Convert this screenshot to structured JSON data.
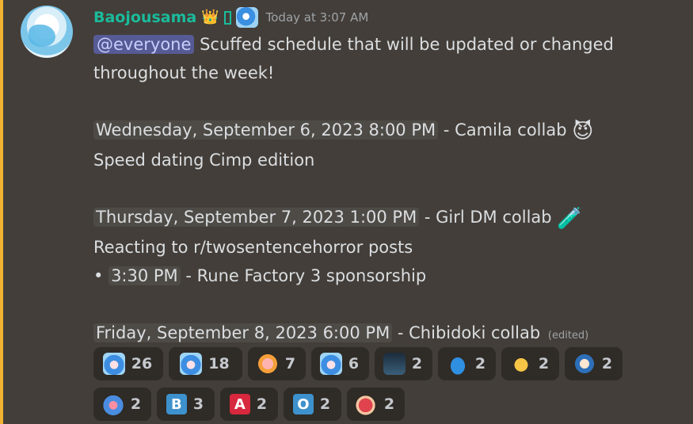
{
  "message": {
    "username": "Baojousama",
    "role_icon_crown": "👑",
    "timestamp": "Today at 3:07 AM",
    "mention": "@everyone",
    "line1_text": " Scuffed schedule that will be updated or changed",
    "line2_text": "throughout the week!",
    "events": {
      "wed_time": "Wednesday, September 6, 2023 8:00 PM",
      "wed_desc": " - Camila collab ",
      "wed_emoji": "😈",
      "wed_note": "Speed dating Cimp edition",
      "thu_time": "Thursday, September 7, 2023 1:00 PM",
      "thu_desc": " - Girl DM collab ",
      "thu_emoji": "🧪",
      "thu_note": "Reacting to r/twosentencehorror posts",
      "thu_bullet": "• ",
      "thu_sub_time": "3:30 PM",
      "thu_sub_desc": " - Rune Factory 3 sponsorship",
      "fri_time": "Friday, September 8, 2023 6:00 PM",
      "fri_desc": " - Chibidoki collab",
      "edited": "(edited)"
    }
  },
  "reactions": [
    {
      "icon": "chibi-blue-hair-icon",
      "count": "26"
    },
    {
      "icon": "chibi-blue-happy-icon",
      "count": "18"
    },
    {
      "icon": "pig-icon",
      "count": "7"
    },
    {
      "icon": "chibi-blue-lying-icon",
      "count": "6"
    },
    {
      "icon": "meme-image-icon",
      "count": "2"
    },
    {
      "icon": "whale-icon",
      "count": "2"
    },
    {
      "icon": "yellow-creature-icon",
      "count": "2"
    },
    {
      "icon": "chibi-scream-icon",
      "count": "2"
    },
    {
      "icon": "chibi-pink-icon",
      "count": "2"
    },
    {
      "icon": "letter-b-icon",
      "letter": "B",
      "count": "3"
    },
    {
      "icon": "letter-a-icon",
      "letter": "A",
      "count": "2"
    },
    {
      "icon": "letter-o-icon",
      "letter": "O",
      "count": "2"
    },
    {
      "icon": "red-character-icon",
      "count": "2"
    }
  ],
  "colors": {
    "background": "#433e39",
    "highlight_bar": "#f0b232",
    "username": "#1abc9c",
    "mention_bg": "#565a95",
    "reaction_bg": "#2f2b26"
  }
}
